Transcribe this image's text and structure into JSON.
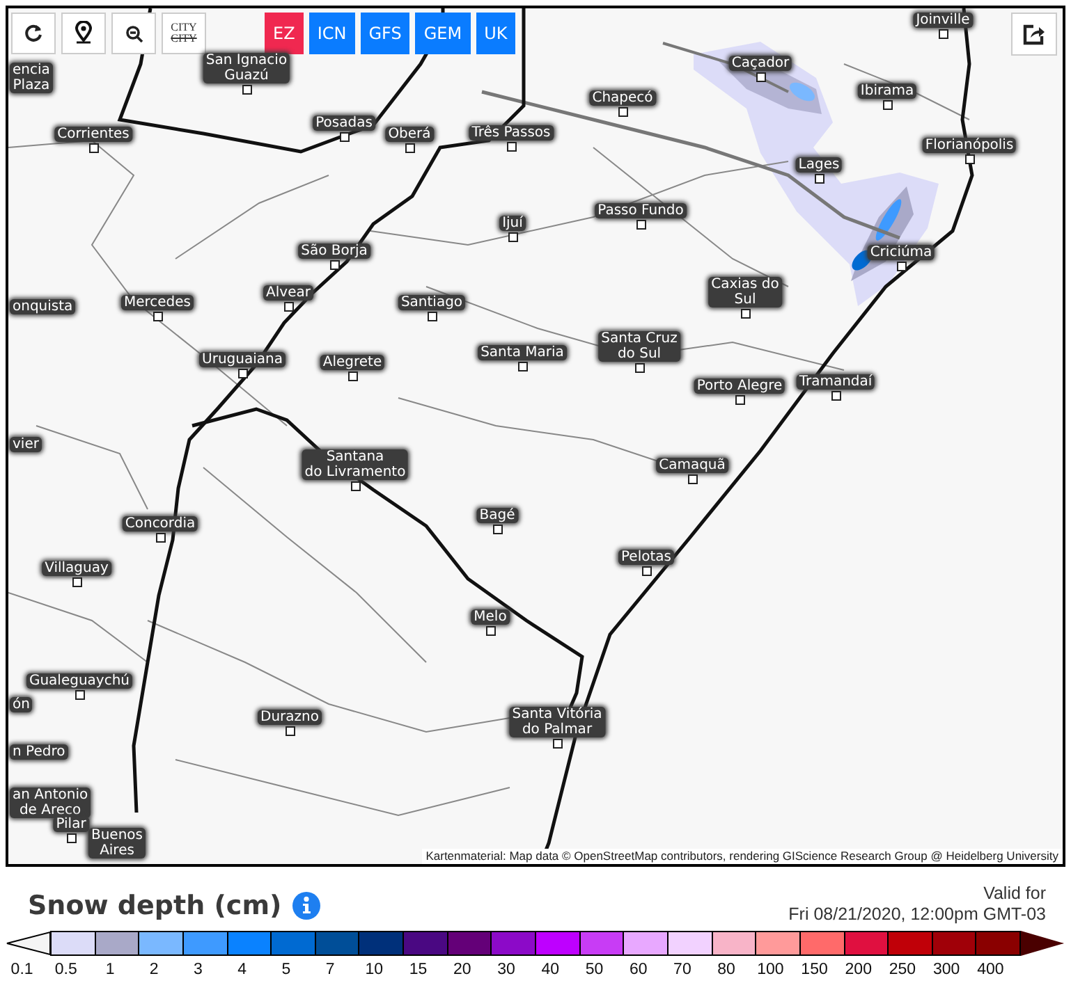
{
  "toolbar": {
    "buttons": [
      {
        "kind": "refresh"
      },
      {
        "kind": "location"
      },
      {
        "kind": "zoom-out"
      },
      {
        "kind": "city-toggle",
        "lines": [
          "CITY",
          "CITY"
        ]
      }
    ]
  },
  "models": [
    {
      "label": "EZ",
      "selected": true
    },
    {
      "label": "ICN",
      "selected": false
    },
    {
      "label": "GFS",
      "selected": false
    },
    {
      "label": "GEM",
      "selected": false
    },
    {
      "label": "UK",
      "selected": false
    }
  ],
  "map": {
    "cities": [
      {
        "lines": [
          "Joinville"
        ]
      },
      {
        "lines": [
          "encia",
          "Plaza"
        ]
      },
      {
        "lines": [
          "San Ignacio",
          "Guazú"
        ]
      },
      {
        "lines": [
          "Caçador"
        ]
      },
      {
        "lines": [
          "Chapecó"
        ]
      },
      {
        "lines": [
          "Ibirama"
        ]
      },
      {
        "lines": [
          "Corrientes"
        ]
      },
      {
        "lines": [
          "Posadas"
        ]
      },
      {
        "lines": [
          "Oberá"
        ]
      },
      {
        "lines": [
          "Três Passos"
        ]
      },
      {
        "lines": [
          "Florianópolis"
        ]
      },
      {
        "lines": [
          "Lages"
        ]
      },
      {
        "lines": [
          "Ijuí"
        ]
      },
      {
        "lines": [
          "Passo Fundo"
        ]
      },
      {
        "lines": [
          "São Borja"
        ]
      },
      {
        "lines": [
          "Criciúma"
        ]
      },
      {
        "lines": [
          "onquista"
        ]
      },
      {
        "lines": [
          "Mercedes"
        ]
      },
      {
        "lines": [
          "Alvear"
        ]
      },
      {
        "lines": [
          "Santiago"
        ]
      },
      {
        "lines": [
          "Caxias do",
          "Sul"
        ]
      },
      {
        "lines": [
          "Santa Maria"
        ]
      },
      {
        "lines": [
          "Santa Cruz",
          "do Sul"
        ]
      },
      {
        "lines": [
          "Uruguaiana"
        ]
      },
      {
        "lines": [
          "Alegrete"
        ]
      },
      {
        "lines": [
          "Porto Alegre"
        ]
      },
      {
        "lines": [
          "Tramandaí"
        ]
      },
      {
        "lines": [
          "vier"
        ]
      },
      {
        "lines": [
          "Santana",
          "do Livramento"
        ]
      },
      {
        "lines": [
          "Camaquã"
        ]
      },
      {
        "lines": [
          "Concordia"
        ]
      },
      {
        "lines": [
          "Bagé"
        ]
      },
      {
        "lines": [
          "Villaguay"
        ]
      },
      {
        "lines": [
          "Pelotas"
        ]
      },
      {
        "lines": [
          "Melo"
        ]
      },
      {
        "lines": [
          "Gualeguaychú"
        ]
      },
      {
        "lines": [
          "ón"
        ]
      },
      {
        "lines": [
          "Durazno"
        ]
      },
      {
        "lines": [
          "Santa Vitória",
          "do Palmar"
        ]
      },
      {
        "lines": [
          "n Pedro"
        ]
      },
      {
        "lines": [
          "an Antonio",
          "de Areco"
        ]
      },
      {
        "lines": [
          "Pilar"
        ]
      },
      {
        "lines": [
          "Buenos",
          "Aires"
        ]
      }
    ],
    "attribution": "Kartenmaterial: Map data © OpenStreetMap contributors, rendering GIScience Research Group @ Heidelberg University"
  },
  "legend": {
    "title": "Snow depth (cm)",
    "valid_label": "Valid for",
    "valid_time": "Fri 08/21/2020, 12:00pm GMT-03",
    "steps": [
      {
        "color": "#dcdcf8"
      },
      {
        "color": "#a9a9c8"
      },
      {
        "color": "#7ab8ff"
      },
      {
        "color": "#3e9aff"
      },
      {
        "color": "#0a82ff"
      },
      {
        "color": "#006ad2"
      },
      {
        "color": "#004e98"
      },
      {
        "color": "#00307a"
      },
      {
        "color": "#4a0882"
      },
      {
        "color": "#640078"
      },
      {
        "color": "#8c0ac8"
      },
      {
        "color": "#be00ff"
      },
      {
        "color": "#c83cf5"
      },
      {
        "color": "#e8a8ff"
      },
      {
        "color": "#f2d2ff"
      },
      {
        "color": "#f8b4c8"
      },
      {
        "color": "#ff9a9a"
      },
      {
        "color": "#ff6a6a"
      },
      {
        "color": "#e01040"
      },
      {
        "color": "#c00008"
      },
      {
        "color": "#a00008"
      },
      {
        "color": "#8a0000"
      }
    ],
    "labels": [
      "0.1",
      "0.5",
      "1",
      "2",
      "3",
      "4",
      "5",
      "7",
      "10",
      "15",
      "20",
      "30",
      "40",
      "50",
      "60",
      "70",
      "80",
      "100",
      "150",
      "200",
      "250",
      "300",
      "400"
    ]
  }
}
